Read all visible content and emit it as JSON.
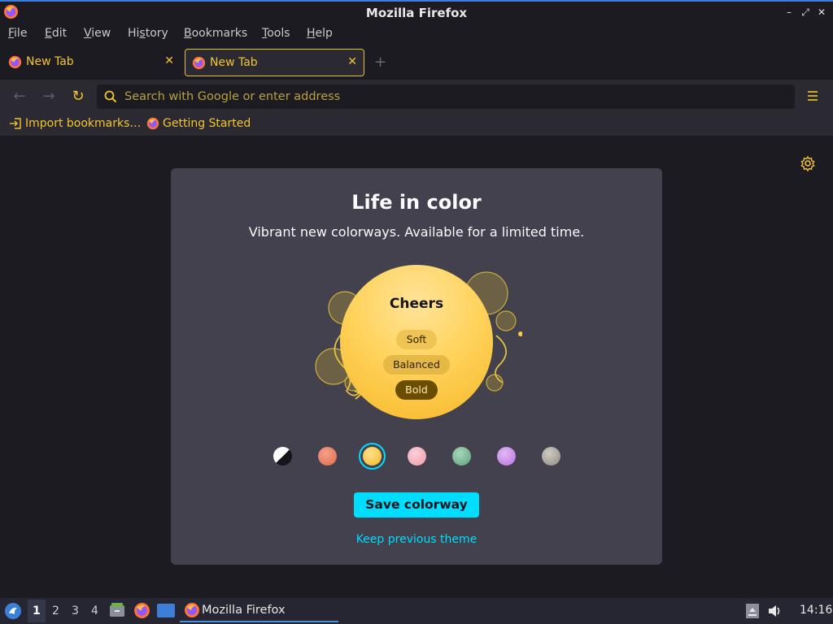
{
  "window": {
    "title": "Mozilla Firefox",
    "controls": {
      "minimize": "–",
      "maximize": "⤢",
      "close": "✕"
    }
  },
  "menubar": {
    "items": [
      {
        "label": "File",
        "accel": "F",
        "rest": "ile"
      },
      {
        "label": "Edit",
        "accel": "E",
        "rest": "dit"
      },
      {
        "label": "View",
        "accel": "V",
        "rest": "iew"
      },
      {
        "label": "History",
        "accel": "s",
        "pre": "Hi",
        "rest": "tory"
      },
      {
        "label": "Bookmarks",
        "accel": "B",
        "rest": "ookmarks"
      },
      {
        "label": "Tools",
        "accel": "T",
        "rest": "ools"
      },
      {
        "label": "Help",
        "accel": "H",
        "rest": "elp"
      }
    ]
  },
  "tabs": [
    {
      "label": "New Tab",
      "close": "✕",
      "active": false
    },
    {
      "label": "New Tab",
      "close": "✕",
      "active": true
    }
  ],
  "newtab_symbol": "+",
  "navbar": {
    "back": "←",
    "forward": "→",
    "reload": "↻",
    "url_placeholder": "Search with Google or enter address"
  },
  "bookmarks": [
    {
      "label": "Import bookmarks…",
      "icon": "import-icon"
    },
    {
      "label": "Getting Started",
      "icon": "firefox-icon"
    }
  ],
  "colorway_card": {
    "heading": "Life in color",
    "subheading": "Vibrant new colorways. Available for a limited time.",
    "colorway_name": "Cheers",
    "intensities": [
      "Soft",
      "Balanced",
      "Bold"
    ],
    "selected_intensity": "Bold",
    "swatches": [
      {
        "name": "default",
        "color": "#ffffff"
      },
      {
        "name": "orange",
        "color": "#e8735a"
      },
      {
        "name": "yellow",
        "color": "#f6c33a",
        "selected": true
      },
      {
        "name": "pink",
        "color": "#f0a4b4"
      },
      {
        "name": "green",
        "color": "#6fae8c"
      },
      {
        "name": "purple",
        "color": "#c685e6"
      },
      {
        "name": "gray",
        "color": "#a19d95"
      }
    ],
    "save_button": "Save colorway",
    "keep_link": "Keep previous theme"
  },
  "taskbar": {
    "workspaces": [
      "1",
      "2",
      "3",
      "4"
    ],
    "active_workspace": "1",
    "task_label": "Mozilla Firefox",
    "clock": "14:16"
  },
  "colors": {
    "accent_yellow": "#f4c430",
    "accent_cyan": "#00ddff",
    "card_bg": "#42414d",
    "page_bg": "#1c1b22"
  }
}
